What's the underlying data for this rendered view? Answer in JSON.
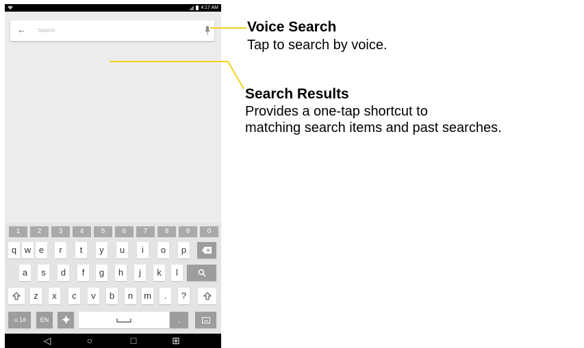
{
  "statusbar": {
    "time": "4:17 AM"
  },
  "search": {
    "placeholder": "Search"
  },
  "keyboard": {
    "number_row": [
      "1",
      "2",
      "3",
      "4",
      "5",
      "6",
      "7",
      "8",
      "9",
      "0"
    ],
    "row1": [
      "q",
      "w",
      "e",
      "r",
      "t",
      "y",
      "u",
      "i",
      "o",
      "p"
    ],
    "row2": [
      "a",
      "s",
      "d",
      "f",
      "g",
      "h",
      "j",
      "k",
      "l"
    ],
    "row3": [
      "z",
      "x",
      "c",
      "v",
      "b",
      "n",
      "m",
      ".",
      "?"
    ],
    "symbols_key": "☺1#",
    "language_key": "EN"
  },
  "callouts": {
    "voice": {
      "title": "Voice Search",
      "description": "Tap to search by voice."
    },
    "results": {
      "title": "Search Results",
      "line1": "Provides a one-tap shortcut to",
      "line2": "matching search items and past searches."
    }
  },
  "colors": {
    "callout_line": "#f2d21b",
    "number_key": "#a9a9a9",
    "function_key": "#9d9d9d"
  }
}
